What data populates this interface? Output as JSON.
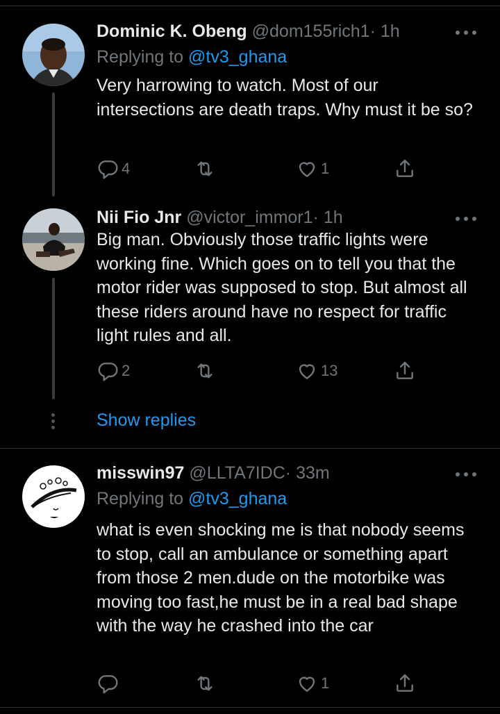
{
  "tweets": [
    {
      "display_name": "Dominic K. Obeng",
      "handle": "@dom155rich1",
      "time": "· 1h",
      "replying_prefix": "Replying to ",
      "replying_to": "@tv3_ghana",
      "text": "Very harrowing to watch. Most of our intersections are death traps. Why must it be so?",
      "reply_count": "4",
      "retweet_count": "",
      "like_count": "1"
    },
    {
      "display_name": "Nii Fio Jnr",
      "handle": "@victor_immor1",
      "time": "· 1h",
      "text": "Big man. Obviously those traffic lights were working fine. Which goes on to tell you that the motor rider was supposed to stop. But almost all these riders around have no respect for traffic light rules and all.",
      "reply_count": "2",
      "retweet_count": "",
      "like_count": "13"
    },
    {
      "display_name": "misswin97",
      "handle": "@LLTA7IDC",
      "time": "· 33m",
      "replying_prefix": "Replying to ",
      "replying_to": "@tv3_ghana",
      "text": "what is even shocking me is that nobody seems to stop, call an ambulance or something apart from those 2 men.dude on the motorbike was moving too fast,he must be in a real bad shape with the way he crashed into the car",
      "reply_count": "",
      "retweet_count": "",
      "like_count": "1"
    }
  ],
  "show_replies_label": "Show replies",
  "colors": {
    "background": "#000000",
    "text": "#e7e9ea",
    "secondary": "#71767b",
    "accent": "#1d9bf0",
    "divider": "#2f3336"
  }
}
